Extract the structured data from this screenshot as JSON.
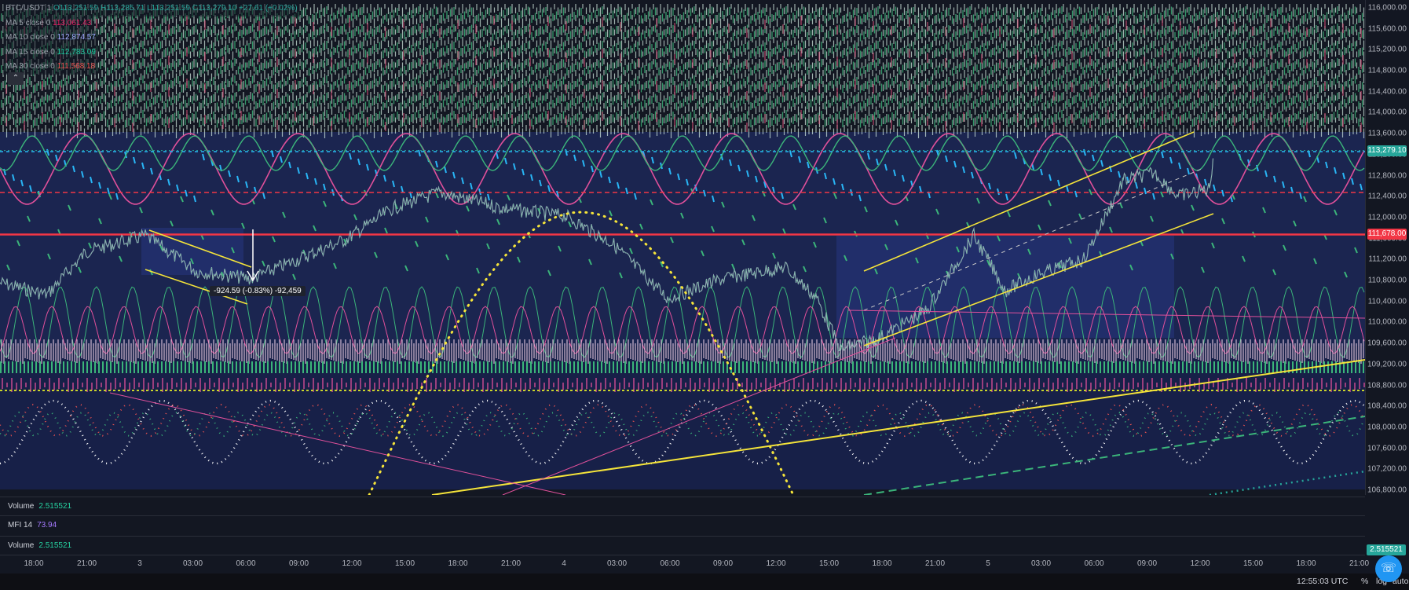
{
  "symbol": {
    "name": "BTC/USDT",
    "interval": "1",
    "ohlc": "O113,251.59 H113,285.71 L113,251.59 C113,279.10 +27.61 (+0.02%)"
  },
  "ma_legend": [
    {
      "label": "MA 5 close 0",
      "value": "113,061.43",
      "color": "#e91e63"
    },
    {
      "label": "MA 10 close 0",
      "value": "112,874.57",
      "color": "#9fa8ff"
    },
    {
      "label": "MA 15 close 0",
      "value": "112,783.09",
      "color": "#1ec9a0"
    },
    {
      "label": "MA 30 close 0",
      "value": "111,568.18",
      "color": "#ef5350"
    }
  ],
  "collapse_icon": "chevron-up-icon",
  "price_axis": {
    "ticks": [
      "116,000.00",
      "115,600.00",
      "115,200.00",
      "114,800.00",
      "114,400.00",
      "114,000.00",
      "113,600.00",
      "113,200.00",
      "112,800.00",
      "112,400.00",
      "112,000.00",
      "111,600.00",
      "111,200.00",
      "110,800.00",
      "110,400.00",
      "110,000.00",
      "109,600.00",
      "109,200.00",
      "108,800.00",
      "108,400.00",
      "108,000.00",
      "107,600.00",
      "107,200.00",
      "106,800.00"
    ],
    "tick_values": [
      116000,
      115600,
      115200,
      114800,
      114400,
      114000,
      113600,
      113200,
      112800,
      112400,
      112000,
      111600,
      111200,
      110800,
      110400,
      110000,
      109600,
      109200,
      108800,
      108400,
      108000,
      107600,
      107200,
      106800
    ],
    "current_price": "113,279.10",
    "current_price_value": 113279.1,
    "current_price_color": "#26a69a",
    "level_price": "111,678.00",
    "level_price_value": 111678,
    "level_color": "#f23645",
    "volume_badge": "2.515521"
  },
  "measure_label": "-924.59 (-0.83%) -92,459",
  "panes": {
    "volume1": {
      "label": "Volume",
      "value": "2.515521"
    },
    "mfi": {
      "label": "MFI 14",
      "value": "73.94"
    },
    "volume2": {
      "label": "Volume",
      "value": "2.515521"
    }
  },
  "time_axis": [
    "18:00",
    "21:00",
    "3",
    "03:00",
    "06:00",
    "09:00",
    "12:00",
    "15:00",
    "18:00",
    "21:00",
    "4",
    "03:00",
    "06:00",
    "09:00",
    "12:00",
    "15:00",
    "18:00",
    "21:00",
    "5",
    "03:00",
    "06:00",
    "09:00",
    "12:00",
    "15:00",
    "18:00",
    "21:00"
  ],
  "footer": {
    "clock": "12:55:03 UTC",
    "percent": "%",
    "log": "log",
    "auto": "auto"
  },
  "help_icon": "headset-icon"
}
